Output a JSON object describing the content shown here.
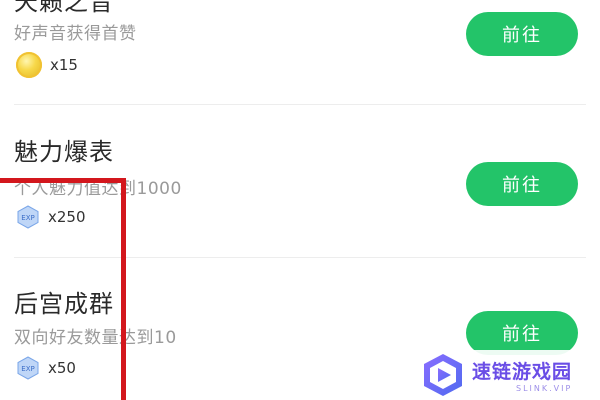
{
  "tasks": [
    {
      "title": "天籁之音",
      "description": "好声音获得首赞",
      "reward_icon": "coin-icon",
      "reward_amount": "x15",
      "button_label": "前往"
    },
    {
      "title": "魅力爆表",
      "description": "个人魅力值达到1000",
      "reward_icon": "exp-icon",
      "reward_amount": "x250",
      "button_label": "前往"
    },
    {
      "title": "后宫成群",
      "description": "双向好友数量达到10",
      "reward_icon": "exp-icon",
      "reward_amount": "x50",
      "button_label": "前往"
    }
  ],
  "exp_icon_text": "EXP",
  "watermark": {
    "title": "速链游戏园",
    "subtitle": "SLINK.VIP"
  },
  "colors": {
    "button": "#23c469",
    "highlight": "#d3171d",
    "watermark": "#6a4ee6"
  }
}
